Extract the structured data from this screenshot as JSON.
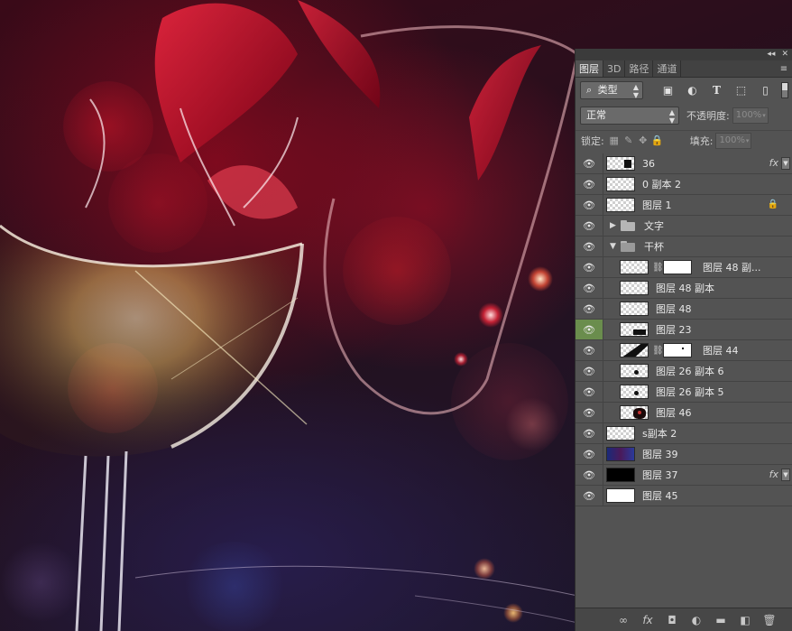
{
  "panel_controls": {
    "collapse_icon": "double-chevron-icon",
    "close_icon": "close-icon",
    "collapse_glyph": "◂◂",
    "close_glyph": "✕"
  },
  "tabs": [
    {
      "label": "图层",
      "active": true
    },
    {
      "label": "3D",
      "active": false
    },
    {
      "label": "路径",
      "active": false
    },
    {
      "label": "通道",
      "active": false
    }
  ],
  "filter": {
    "search_glyph": "⌕",
    "type_label": "类型",
    "kind_icons": [
      "image-filter-icon",
      "adjustment-filter-icon",
      "text-filter-icon",
      "shape-filter-icon",
      "smart-object-filter-icon"
    ]
  },
  "blend": {
    "mode": "正常",
    "opacity_label": "不透明度:",
    "opacity_value": "100%"
  },
  "lock": {
    "label": "锁定:",
    "fill_label": "填充:",
    "fill_value": "100%"
  },
  "layers": [
    {
      "name": "36",
      "indent": 0,
      "thumb": "checker-smart",
      "fx": true,
      "locked": false,
      "visible_highlight": false
    },
    {
      "name": "0 副本 2",
      "indent": 0,
      "thumb": "checker",
      "fx": false
    },
    {
      "name": "图层 1",
      "indent": 0,
      "thumb": "checker",
      "fx": false,
      "locked": true
    },
    {
      "name": "文字",
      "indent": 0,
      "group": true,
      "open": false
    },
    {
      "name": "干杯",
      "indent": 0,
      "group": true,
      "open": true
    },
    {
      "name": "图层 48 副...",
      "indent": 1,
      "thumb": "checker",
      "mask": true
    },
    {
      "name": "图层 48 副本",
      "indent": 1,
      "thumb": "checker"
    },
    {
      "name": "图层 48",
      "indent": 1,
      "thumb": "checker"
    },
    {
      "name": "图层 23",
      "indent": 1,
      "thumb": "checker-dark",
      "active_eye": true
    },
    {
      "name": "图层 44",
      "indent": 1,
      "thumb": "checker-triangle",
      "mask": true
    },
    {
      "name": "图层 26 副本 6",
      "indent": 1,
      "thumb": "checker-dot"
    },
    {
      "name": "图层 26 副本 5",
      "indent": 1,
      "thumb": "checker-dot"
    },
    {
      "name": "图层 46",
      "indent": 1,
      "thumb": "checker-blob"
    },
    {
      "name": "s副本 2",
      "indent": 0,
      "thumb": "checker"
    },
    {
      "name": "图层 39",
      "indent": 0,
      "thumb": "blue"
    },
    {
      "name": "图层 37",
      "indent": 0,
      "thumb": "black",
      "fx": true
    },
    {
      "name": "图层 45",
      "indent": 0,
      "thumb": "white"
    }
  ],
  "symbols": {
    "eye": "👁",
    "chain": "⛓",
    "fx": "fx",
    "lock": "🔒",
    "twisty_closed": "▶",
    "twisty_open": "▼",
    "dropdown_arrows": "▲▼",
    "fx_toggle": "▼",
    "menu": "≡"
  },
  "footer_icons": [
    {
      "name": "link-layers-icon",
      "glyph": "∞"
    },
    {
      "name": "fx-icon",
      "glyph": "fx"
    },
    {
      "name": "add-mask-icon",
      "glyph": "◘"
    },
    {
      "name": "adjustment-layer-icon",
      "glyph": "◐"
    },
    {
      "name": "new-group-icon",
      "glyph": "▬"
    },
    {
      "name": "new-layer-icon",
      "glyph": "◧"
    },
    {
      "name": "delete-layer-icon",
      "glyph": "🗑"
    }
  ],
  "colors": {
    "panel_bg": "#535353",
    "active_eye_bg": "#6a8d4d",
    "wine_red": "#c0102a"
  }
}
